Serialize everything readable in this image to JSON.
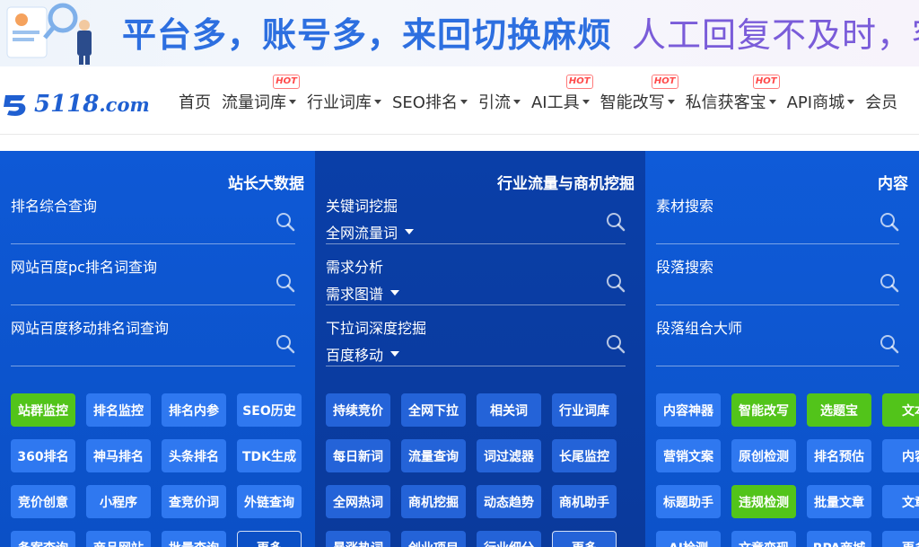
{
  "banner": {
    "text_part1": "平台多，账号多，来回切换麻烦",
    "text_part2": "人工回复不及时，客"
  },
  "logo": {
    "brand": "5118",
    "domain": ".com"
  },
  "nav": {
    "items": [
      {
        "label": "首页",
        "dropdown": false,
        "hot": ""
      },
      {
        "label": "流量词库",
        "dropdown": true,
        "hot": "HOT"
      },
      {
        "label": "行业词库",
        "dropdown": true,
        "hot": ""
      },
      {
        "label": "SEO排名",
        "dropdown": true,
        "hot": ""
      },
      {
        "label": "引流",
        "dropdown": true,
        "hot": ""
      },
      {
        "label": "AI工具",
        "dropdown": true,
        "hot": "HOT"
      },
      {
        "label": "智能改写",
        "dropdown": true,
        "hot": "HOT"
      },
      {
        "label": "私信获客宝",
        "dropdown": true,
        "hot": "HOT"
      },
      {
        "label": "API商城",
        "dropdown": true,
        "hot": ""
      },
      {
        "label": "会员",
        "dropdown": false,
        "hot": ""
      }
    ]
  },
  "panels": [
    {
      "title": "站长大数据",
      "fields": [
        {
          "label": "排名综合查询",
          "sub": ""
        },
        {
          "label": "网站百度pc排名词查询",
          "sub": ""
        },
        {
          "label": "网站百度移动排名词查询",
          "sub": ""
        }
      ],
      "buttons": [
        {
          "label": "站群监控",
          "style": "green"
        },
        {
          "label": "排名监控",
          "style": ""
        },
        {
          "label": "排名内参",
          "style": ""
        },
        {
          "label": "SEO历史",
          "style": ""
        },
        {
          "label": "360排名",
          "style": ""
        },
        {
          "label": "神马排名",
          "style": ""
        },
        {
          "label": "头条排名",
          "style": ""
        },
        {
          "label": "TDK生成",
          "style": ""
        },
        {
          "label": "竞价创意",
          "style": ""
        },
        {
          "label": "小程序",
          "style": ""
        },
        {
          "label": "查竞价词",
          "style": ""
        },
        {
          "label": "外链查询",
          "style": ""
        },
        {
          "label": "备案查询",
          "style": ""
        },
        {
          "label": "商品网站",
          "style": ""
        },
        {
          "label": "批量查询",
          "style": ""
        },
        {
          "label": "更多",
          "style": "more"
        }
      ]
    },
    {
      "title": "行业流量与商机挖掘",
      "fields": [
        {
          "label": "关键词挖掘",
          "sub": "全网流量词"
        },
        {
          "label": "需求分析",
          "sub": "需求图谱"
        },
        {
          "label": "下拉词深度挖掘",
          "sub": "百度移动"
        }
      ],
      "buttons": [
        {
          "label": "持续竞价",
          "style": ""
        },
        {
          "label": "全网下拉",
          "style": ""
        },
        {
          "label": "相关词",
          "style": ""
        },
        {
          "label": "行业词库",
          "style": ""
        },
        {
          "label": "每日新词",
          "style": ""
        },
        {
          "label": "流量查询",
          "style": ""
        },
        {
          "label": "词过滤器",
          "style": "green"
        },
        {
          "label": "长尾监控",
          "style": ""
        },
        {
          "label": "全网热词",
          "style": ""
        },
        {
          "label": "商机挖掘",
          "style": "green"
        },
        {
          "label": "动态趋势",
          "style": ""
        },
        {
          "label": "商机助手",
          "style": ""
        },
        {
          "label": "暴涨热词",
          "style": ""
        },
        {
          "label": "创业项目",
          "style": ""
        },
        {
          "label": "行业细分",
          "style": ""
        },
        {
          "label": "更多",
          "style": "more"
        }
      ]
    },
    {
      "title": "内容",
      "fields": [
        {
          "label": "素材搜索",
          "sub": ""
        },
        {
          "label": "段落搜索",
          "sub": ""
        },
        {
          "label": "段落组合大师",
          "sub": ""
        }
      ],
      "buttons": [
        {
          "label": "内容神器",
          "style": ""
        },
        {
          "label": "智能改写",
          "style": "green"
        },
        {
          "label": "选题宝",
          "style": "green"
        },
        {
          "label": "文本",
          "style": "green"
        },
        {
          "label": "营销文案",
          "style": ""
        },
        {
          "label": "原创检测",
          "style": ""
        },
        {
          "label": "排名预估",
          "style": ""
        },
        {
          "label": "内容",
          "style": ""
        },
        {
          "label": "标题助手",
          "style": ""
        },
        {
          "label": "违规检测",
          "style": "green"
        },
        {
          "label": "批量文章",
          "style": ""
        },
        {
          "label": "文章",
          "style": ""
        },
        {
          "label": "AI检测",
          "style": ""
        },
        {
          "label": "文章变现",
          "style": ""
        },
        {
          "label": "RPA商城",
          "style": ""
        },
        {
          "label": "更多",
          "style": ""
        }
      ]
    }
  ],
  "colors": {
    "brand": "#1f5fd1",
    "green": "#52c41a",
    "hot": "#ff4a4a"
  }
}
